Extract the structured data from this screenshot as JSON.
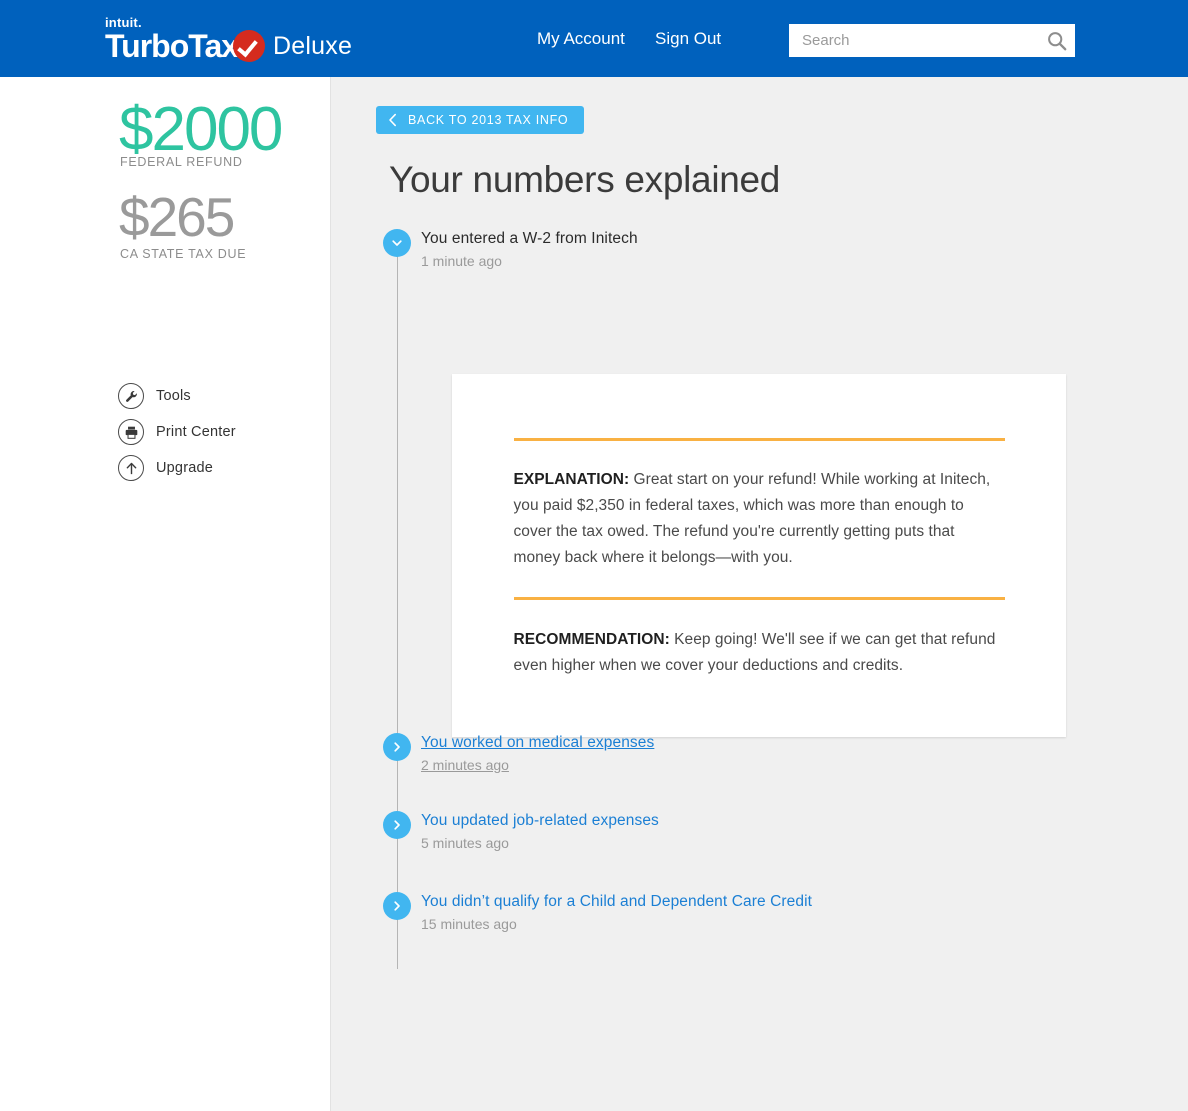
{
  "header": {
    "logo": {
      "intuit": "intuit.",
      "product": "TurboTax",
      "check_icon": "red-check-badge-icon",
      "edition": "Deluxe"
    },
    "nav": [
      {
        "label": "My Account",
        "name": "nav-my-account"
      },
      {
        "label": "Sign Out",
        "name": "nav-sign-out"
      }
    ],
    "search": {
      "placeholder": "Search",
      "value": "",
      "icon": "search-icon"
    },
    "background_color": "#0061bd"
  },
  "sidebar": {
    "federal": {
      "amount": "$2000",
      "label": "FEDERAL REFUND",
      "color": "#2ec4a0"
    },
    "state": {
      "amount": "$265",
      "label": "CA STATE TAX DUE",
      "color": "#9a9a9a"
    },
    "menu": [
      {
        "label": "Tools",
        "icon": "wrench-icon"
      },
      {
        "label": "Print Center",
        "icon": "printer-icon"
      },
      {
        "label": "Upgrade",
        "icon": "arrow-up-icon"
      }
    ]
  },
  "main": {
    "back_button": {
      "label": "BACK TO 2013 TAX INFO",
      "icon": "chevron-left-icon",
      "color": "#41b6f0"
    },
    "title": "Your numbers explained",
    "timeline": [
      {
        "title": "You entered a W-2 from Initech",
        "time": "1 minute ago",
        "expanded": true,
        "hovered": false,
        "icon": "chevron-down-icon"
      },
      {
        "title": "You worked on medical expenses",
        "time": "2 minutes ago",
        "expanded": false,
        "hovered": true,
        "icon": "chevron-right-icon"
      },
      {
        "title": "You updated job-related expenses",
        "time": "5 minutes ago",
        "expanded": false,
        "hovered": false,
        "icon": "chevron-right-icon"
      },
      {
        "title": "You didn’t qualify for a Child and Dependent Care Credit",
        "time": "15 minutes ago",
        "expanded": false,
        "hovered": false,
        "icon": "chevron-right-icon"
      }
    ],
    "explanation_card": {
      "rule_color": "#f9b143",
      "explanation_key": "EXPLANATION:",
      "explanation_text": " Great start on your refund! While working at Initech, you paid $2,350 in federal taxes, which was more than enough to cover the tax owed. The refund you're currently getting puts that money back where it belongs—with you.",
      "recommendation_key": "RECOMMENDATION:",
      "recommendation_text": " Keep going! We'll see if we can get that refund even higher when we cover your deductions and credits."
    }
  }
}
